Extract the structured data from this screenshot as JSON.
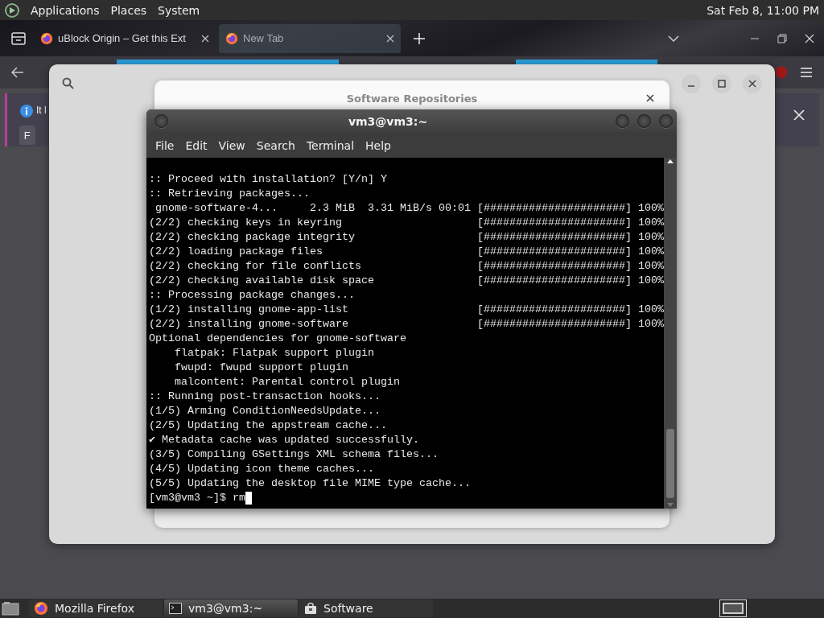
{
  "top_panel": {
    "menus": [
      "Applications",
      "Places",
      "System"
    ],
    "clock": "Sat Feb 8, 11:00 PM"
  },
  "browser": {
    "tabs": [
      {
        "label": "uBlock Origin – Get this Ext",
        "selected": false
      },
      {
        "label": "New Tab",
        "selected": true
      }
    ],
    "notification": {
      "text": "It l",
      "button": "F"
    }
  },
  "repositories_dialog": {
    "title": "Software Repositories"
  },
  "terminal": {
    "title": "vm3@vm3:~",
    "menus": [
      "File",
      "Edit",
      "View",
      "Search",
      "Terminal",
      "Help"
    ],
    "lines": [
      {
        "text": ":: Proceed with installation? [Y/n] Y"
      },
      {
        "text": ":: Retrieving packages..."
      },
      {
        "text": " gnome-software-4...     2.3 MiB  3.31 MiB/s 00:01",
        "bar": "[######################]",
        "percent": "100%"
      },
      {
        "text": "(2/2) checking keys in keyring",
        "bar": "[######################]",
        "percent": "100%"
      },
      {
        "text": "(2/2) checking package integrity",
        "bar": "[######################]",
        "percent": "100%"
      },
      {
        "text": "(2/2) loading package files",
        "bar": "[######################]",
        "percent": "100%"
      },
      {
        "text": "(2/2) checking for file conflicts",
        "bar": "[######################]",
        "percent": "100%"
      },
      {
        "text": "(2/2) checking available disk space",
        "bar": "[######################]",
        "percent": "100%"
      },
      {
        "text": ":: Processing package changes..."
      },
      {
        "text": "(1/2) installing gnome-app-list",
        "bar": "[######################]",
        "percent": "100%"
      },
      {
        "text": "(2/2) installing gnome-software",
        "bar": "[######################]",
        "percent": "100%"
      },
      {
        "text": "Optional dependencies for gnome-software"
      },
      {
        "text": "    flatpak: Flatpak support plugin"
      },
      {
        "text": "    fwupd: fwupd support plugin"
      },
      {
        "text": "    malcontent: Parental control plugin"
      },
      {
        "text": ":: Running post-transaction hooks..."
      },
      {
        "text": "(1/5) Arming ConditionNeedsUpdate..."
      },
      {
        "text": "(2/5) Updating the appstream cache..."
      },
      {
        "text": "✔ Metadata cache was updated successfully."
      },
      {
        "text": "(3/5) Compiling GSettings XML schema files..."
      },
      {
        "text": "(4/5) Updating icon theme caches..."
      },
      {
        "text": "(5/5) Updating the desktop file MIME type cache..."
      }
    ],
    "prompt": "[vm3@vm3 ~]$ rm"
  },
  "taskbar": {
    "items": [
      {
        "label": "Mozilla Firefox",
        "kind": "browser",
        "selected": false
      },
      {
        "label": "vm3@vm3:~",
        "kind": "terminal",
        "selected": true
      },
      {
        "label": "Software",
        "kind": "software",
        "selected": false
      }
    ]
  }
}
